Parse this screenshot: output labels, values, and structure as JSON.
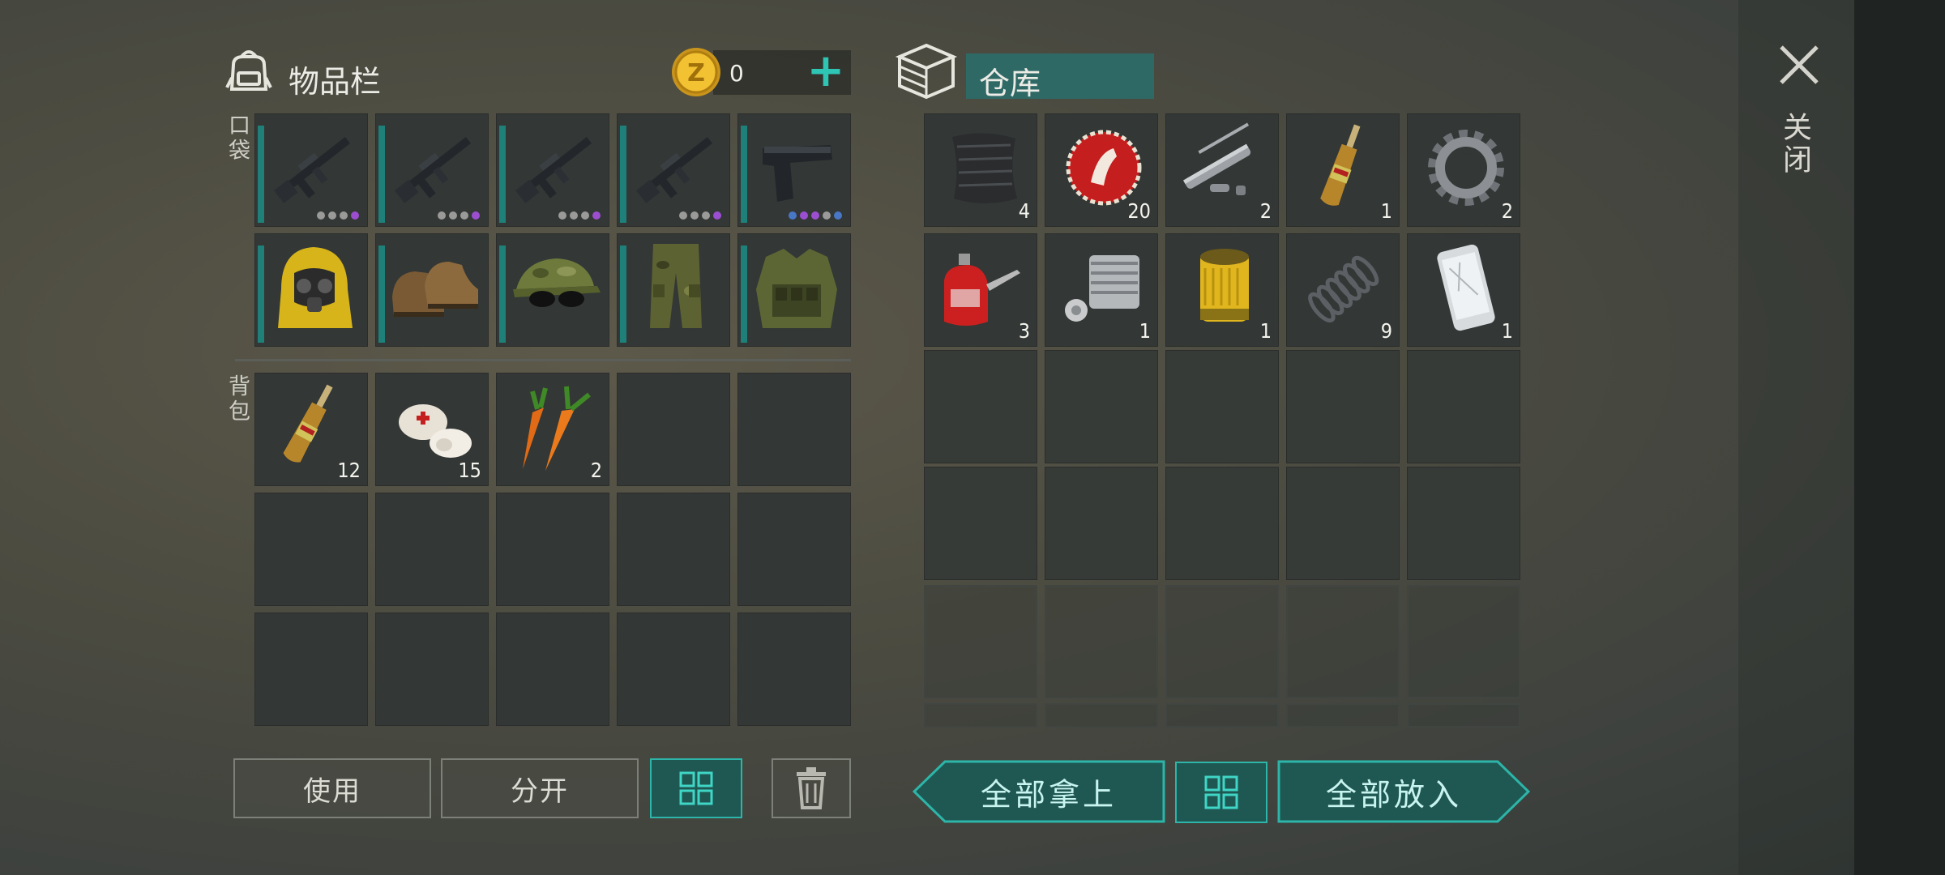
{
  "inventory": {
    "title": "物品栏",
    "pocket_label": "口袋",
    "backpack_label": "背包",
    "coins": "0",
    "equipment_row1": [
      {
        "icon": "assault-rifle-icon",
        "dots": [
          "g",
          "g",
          "g",
          "p"
        ]
      },
      {
        "icon": "assault-rifle-icon",
        "dots": [
          "g",
          "g",
          "g",
          "p"
        ]
      },
      {
        "icon": "assault-rifle-icon",
        "dots": [
          "g",
          "g",
          "g",
          "p"
        ]
      },
      {
        "icon": "assault-rifle-icon",
        "dots": [
          "g",
          "g",
          "g",
          "p"
        ]
      },
      {
        "icon": "pistol-icon",
        "dots": [
          "b",
          "p",
          "p",
          "g",
          "b"
        ]
      }
    ],
    "equipment_row2": [
      {
        "icon": "hazmat-hood-icon"
      },
      {
        "icon": "boots-icon"
      },
      {
        "icon": "camo-cap-sunglasses-icon"
      },
      {
        "icon": "camo-pants-icon"
      },
      {
        "icon": "tactical-vest-icon"
      }
    ],
    "backpack": [
      {
        "icon": "ampoule-icon",
        "count": "12"
      },
      {
        "icon": "bandage-icon",
        "count": "15"
      },
      {
        "icon": "carrot-icon",
        "count": "2"
      }
    ]
  },
  "warehouse": {
    "title": "仓库",
    "items": [
      {
        "icon": "carbon-fabric-icon",
        "count": "4"
      },
      {
        "icon": "bottle-cap-icon",
        "count": "20"
      },
      {
        "icon": "pipe-parts-icon",
        "count": "2"
      },
      {
        "icon": "ampoule-icon",
        "count": "1"
      },
      {
        "icon": "gear-icon",
        "count": "2"
      },
      {
        "icon": "oil-can-icon",
        "count": "3"
      },
      {
        "icon": "engine-cylinder-icon",
        "count": "1"
      },
      {
        "icon": "oil-filter-icon",
        "count": "1"
      },
      {
        "icon": "spring-icon",
        "count": "9"
      },
      {
        "icon": "smartphone-icon",
        "count": "1"
      }
    ]
  },
  "buttons": {
    "use": "使用",
    "split": "分开",
    "take_all": "全部拿上",
    "put_all": "全部放入"
  },
  "close_label": "关闭",
  "colors": {
    "accent": "#2cb5a8",
    "accent_dark": "#1f5753",
    "slot_bg": "#333735"
  }
}
